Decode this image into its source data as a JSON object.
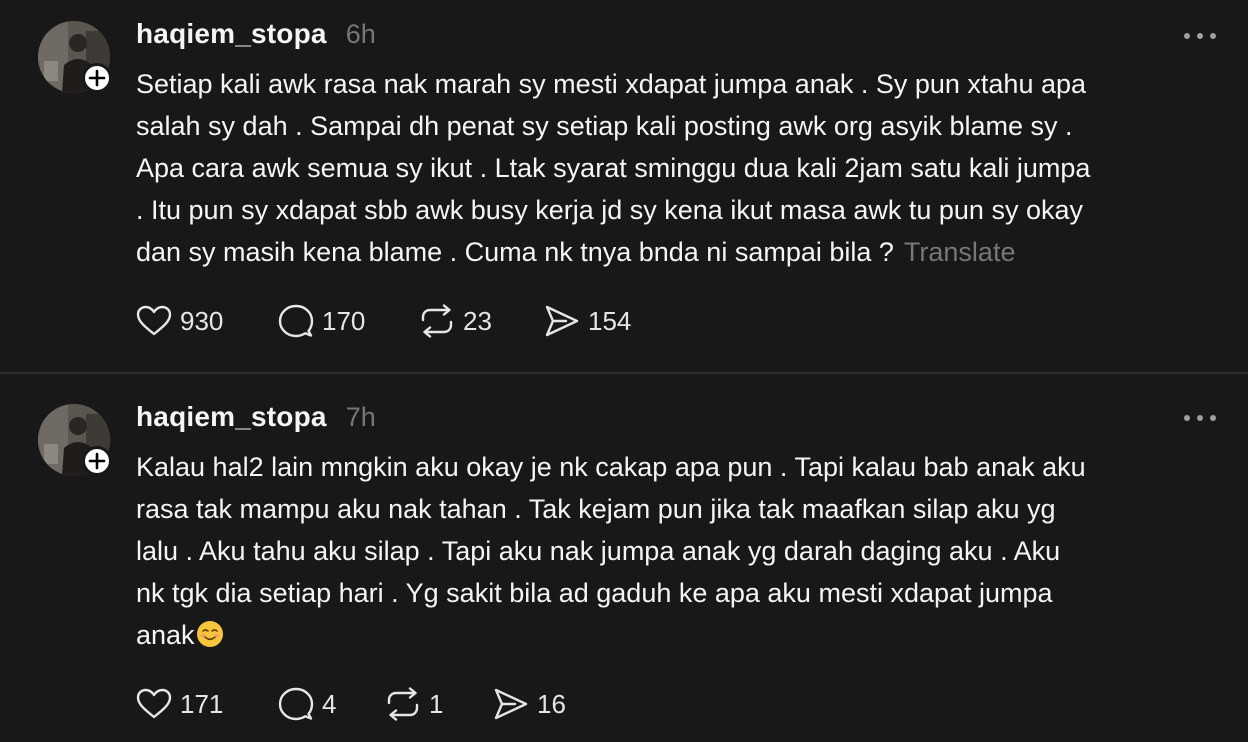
{
  "posts": [
    {
      "username": "haqiem_stopa",
      "time": "6h",
      "lines": [
        "Setiap kali awk rasa nak marah sy mesti xdapat jumpa anak . Sy pun xtahu apa",
        "salah sy dah . Sampai dh penat sy setiap kali posting awk org asyik blame sy .",
        "Apa cara awk semua sy ikut . Ltak syarat sminggu dua kali 2jam satu kali jumpa",
        ". Itu pun sy xdapat sbb awk busy kerja jd sy kena ikut masa awk tu pun sy okay",
        "dan sy masih kena blame . Cuma nk tnya bnda ni sampai bila ?"
      ],
      "translate_label": "Translate",
      "likes": "930",
      "replies": "170",
      "reposts": "23",
      "shares": "154"
    },
    {
      "username": "haqiem_stopa",
      "time": "7h",
      "lines": [
        "Kalau hal2 lain mngkin aku okay je nk cakap apa pun . Tapi kalau bab anak aku",
        "rasa tak mampu aku nak tahan . Tak kejam pun jika tak maafkan silap aku yg",
        "lalu . Aku tahu aku silap . Tapi aku nak jumpa anak yg darah daging aku . Aku",
        "nk tgk dia setiap hari . Yg sakit bila ad gaduh ke apa aku mesti xdapat jumpa",
        "anak"
      ],
      "emoji_icon": "smiling-face-emoji",
      "likes": "171",
      "replies": "4",
      "reposts": "1",
      "shares": "16"
    }
  ],
  "icons": {
    "like": "heart-icon",
    "reply": "comment-bubble-icon",
    "repost": "repost-icon",
    "share": "send-icon",
    "more": "more-options-icon",
    "follow": "plus-icon"
  },
  "colors": {
    "background": "#181818",
    "text": "#f3f5f7",
    "muted": "#777777",
    "divider": "#2d2d2d"
  }
}
